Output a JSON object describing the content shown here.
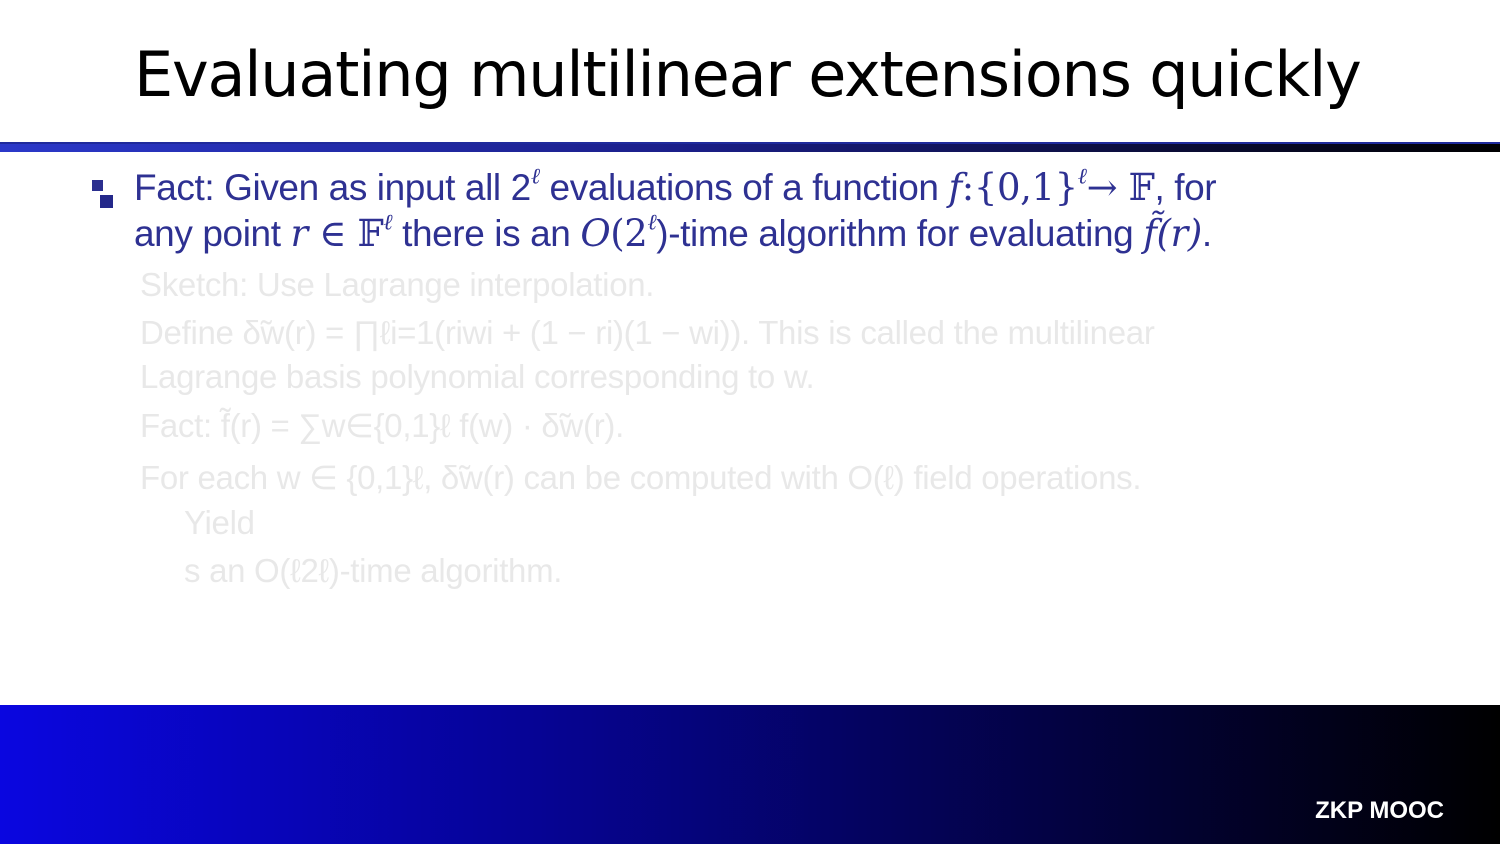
{
  "slide": {
    "title": "Evaluating multilinear extensions quickly"
  },
  "fact": {
    "line1": {
      "a": "Fact: Given as input all 2",
      "a_sup": "ℓ",
      "b": " evaluations of a function ",
      "f": "f",
      "c": ":{0,1}",
      "c_sup": "ℓ",
      "d": "→ 𝔽",
      "e": ", for"
    },
    "line2": {
      "a": "any point ",
      "r": "r",
      "b": " ∈ 𝔽",
      "b_sup": "ℓ",
      "c": " there is an ",
      "o": "O",
      "d": "(2",
      "d_sup": "ℓ",
      "e": ")-time algorithm for evaluating ",
      "ft": "f̃",
      "g": "(r)",
      "h": "."
    }
  },
  "ghost_lines": [
    "Sketch: Use Lagrange interpolation.",
    "Define δ̃w(r) = ∏ℓi=1(riwi + (1 − ri)(1 − wi)). This is called the multilinear",
    "Lagrange basis polynomial corresponding to w.",
    "Fact: f̃(r) = ∑w∈{0,1}ℓ f(w) · δ̃w(r).",
    "For each w ∈ {0,1}ℓ, δ̃w(r) can be computed with O(ℓ) field operations.",
    "Yield",
    "s an O(ℓ2ℓ)-time algorithm."
  ],
  "footer": {
    "label": "ZKP MOOC"
  },
  "colors": {
    "fact_text": "#2e3192",
    "rule_start": "#2b38c9",
    "rule_end": "#000000",
    "footer_start": "#0a06e0",
    "footer_end": "#000000"
  }
}
